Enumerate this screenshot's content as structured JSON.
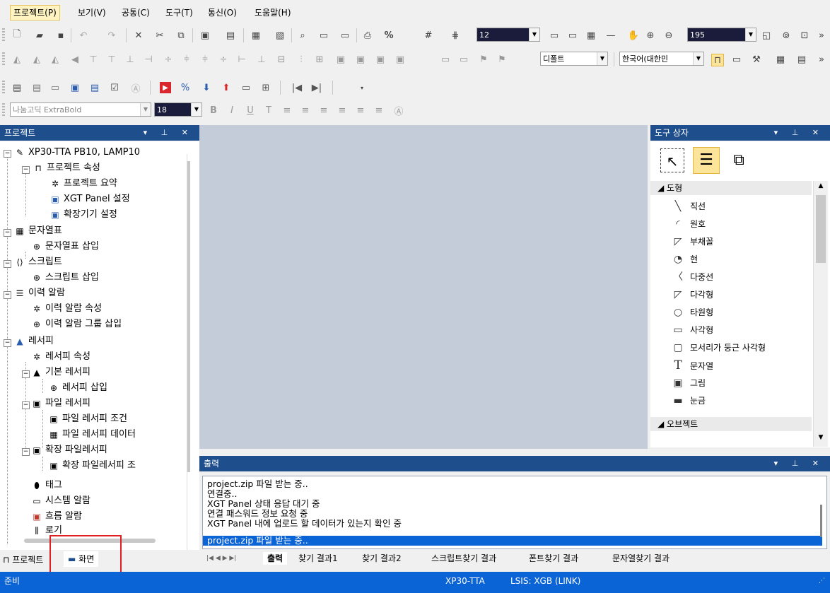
{
  "menu": [
    "프로젝트(P)",
    "보기(V)",
    "공통(C)",
    "도구(T)",
    "통신(O)",
    "도움말(H)"
  ],
  "toolbar": {
    "font_size_combo": "12",
    "zoom_combo": "195",
    "language_default": "디폴트",
    "language_combo": "한국어(대한민",
    "font_family": "나눔고딕 ExtraBold",
    "text_size": "18"
  },
  "project_panel": {
    "title": "프로젝트",
    "root": "XP30-TTA PB10, LAMP10",
    "items": [
      "프로젝트 속성",
      "프로젝트 요약",
      "XGT Panel 설정",
      "확장기기 설정",
      "문자열표",
      "문자열표 삽입",
      "스크립트",
      "스크립트 삽입",
      "이력 알람",
      "이력 알람 속성",
      "이력 알람 그룹 삽입",
      "레서피",
      "레서피 속성",
      "기본 레서피",
      "레서피 삽입",
      "파일 레서피",
      "파일 레서피 조건",
      "파일 레서피 데이터",
      "확장 파일레서피",
      "확장 파일레서피 조",
      "태그",
      "시스템 알람",
      "흐름 알람",
      "로기"
    ],
    "tab_project": "프로젝트",
    "tab_screen": "화면"
  },
  "toolbox": {
    "title": "도구 상자",
    "group_shapes": "도형",
    "shapes": [
      "직선",
      "원호",
      "부채꼴",
      "현",
      "다중선",
      "다각형",
      "타원형",
      "사각형",
      "모서리가 둥근 사각형",
      "문자열",
      "그림",
      "눈금"
    ],
    "group_objects": "오브젝트"
  },
  "output": {
    "title": "출력",
    "lines": [
      "project.zip 파일 받는 중..",
      "연결중..",
      "XGT Panel 상태 응답 대기 중",
      "연결 패스워드 정보 요청 중",
      "XGT Panel 내에 업로드 할 데이터가 있는지 확인 중",
      "project.zip 파일 받는 중.."
    ],
    "tabs": [
      "출력",
      "찾기 결과1",
      "찾기 결과2",
      "스크립트찾기 결과",
      "폰트찾기 결과",
      "문자열찾기 결과"
    ]
  },
  "status": {
    "left": "준비",
    "device": "XP30-TTA",
    "connection": "LSIS: XGB (LINK)"
  },
  "colors": {
    "panel_header": "#1f4e8c",
    "status_bar": "#0a64d6",
    "canvas": "#c5ccd9",
    "highlight": "#e02020"
  }
}
